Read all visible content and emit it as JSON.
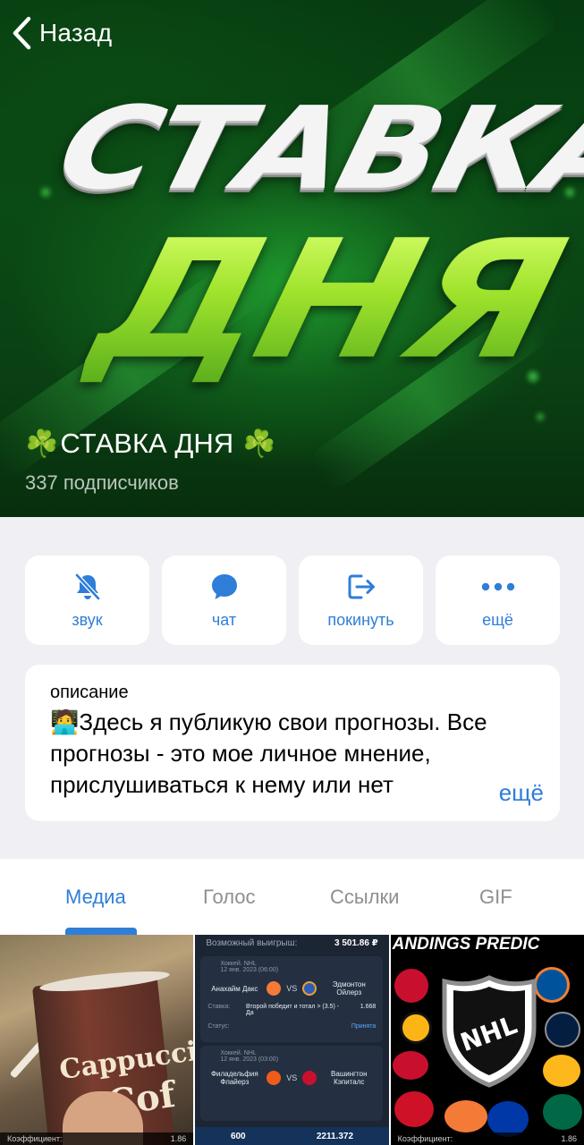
{
  "header": {
    "back_label": "Назад"
  },
  "hero": {
    "art_word_1": "СТАВКА",
    "art_word_2": "ДНЯ",
    "channel_name": "СТАВКА ДНЯ",
    "clover_emoji": "☘️",
    "subscribers": "337 подписчиков"
  },
  "actions": [
    {
      "label": "звук",
      "icon": "bell-slash-icon"
    },
    {
      "label": "чат",
      "icon": "chat-bubble-icon"
    },
    {
      "label": "покинуть",
      "icon": "leave-icon"
    },
    {
      "label": "ещё",
      "icon": "more-dots-icon"
    }
  ],
  "description": {
    "title": "описание",
    "emoji": "🧑‍💻",
    "text": "Здесь я публикую свои прогнозы. Все прогнозы - это мое личное мнение, прислушиваться к нему или нет",
    "more_label": "ещё"
  },
  "tabs": [
    {
      "label": "Медиа",
      "active": true
    },
    {
      "label": "Голос",
      "active": false
    },
    {
      "label": "Ссылки",
      "active": false
    },
    {
      "label": "GIF",
      "active": false
    }
  ],
  "media": {
    "cup": {
      "word_1": "Cappuccin",
      "word_2": "Cof"
    },
    "bet_slip": {
      "possible_win_label": "Возможный выигрыш:",
      "possible_win_value": "3 501.86 ₽",
      "cards": [
        {
          "league": "Хоккей. NHL",
          "date": "12 янв. 2023 (06:00)",
          "team_home": "Анахайм Дакс",
          "team_away": "Эдмонтон Ойлерз",
          "bet_label": "Ставка:",
          "bet_value": "Второй победит и тотал > (3.5) - Да",
          "odds": "1.668",
          "status_label": "Статус:",
          "status_value": "Принята"
        },
        {
          "league": "Хоккей. NHL",
          "date": "12 янв. 2023 (03:00)",
          "team_home": "Филадельфия Флайерз",
          "team_away": "Вашингтон Кэпиталс"
        }
      ],
      "vs": "VS",
      "stake_value": "600",
      "max_win_value": "2211.372"
    },
    "nhl": {
      "banner": "ANDINGS PREDIC",
      "shield_text": "NHL"
    },
    "coef_label": "Коэффициент:",
    "coef_value": "1.86"
  },
  "colors": {
    "accent": "#2f7ed8",
    "background": "#efeff4",
    "card": "#ffffff",
    "muted_text": "#8e8e93"
  }
}
